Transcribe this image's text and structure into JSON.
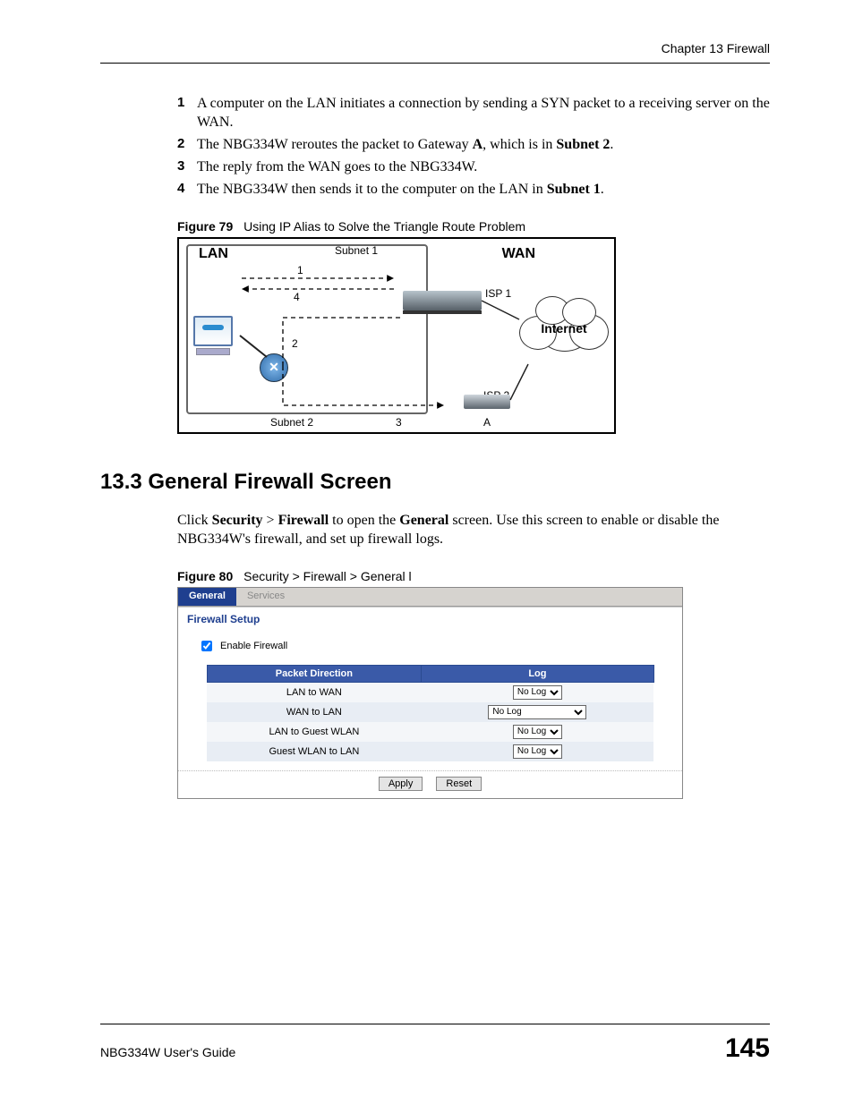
{
  "header": {
    "chapter": "Chapter 13 Firewall"
  },
  "steps": [
    {
      "n": "1",
      "text_before": "A computer on the LAN initiates a connection by sending a SYN packet to a receiving server on the WAN.",
      "bold_parts": []
    },
    {
      "n": "2",
      "text_before": "The NBG334W reroutes the packet to Gateway ",
      "bold1": "A",
      "text_mid": ", which is in ",
      "bold2": "Subnet 2",
      "text_after": "."
    },
    {
      "n": "3",
      "text_before": "The reply from the WAN goes to the NBG334W."
    },
    {
      "n": "4",
      "text_before": "The NBG334W then sends it to the computer on the LAN in ",
      "bold1": "Subnet 1",
      "text_after": "."
    }
  ],
  "fig79": {
    "label_num": "Figure 79",
    "label_title": "Using IP Alias to Solve the Triangle Route Problem",
    "lan": "LAN",
    "wan": "WAN",
    "subnet1": "Subnet 1",
    "subnet2": "Subnet 2",
    "isp1": "ISP 1",
    "isp2": "ISP 2",
    "internet": "Internet",
    "n1": "1",
    "n2": "2",
    "n3": "3",
    "n4": "4",
    "nA": "A",
    "hub": "✕"
  },
  "section": {
    "heading": "13.3  General Firewall Screen",
    "para_plain1": "Click ",
    "b1": "Security",
    "gt1": " > ",
    "b2": "Firewall",
    "mid": " to open the ",
    "b3": "General",
    "tail": " screen. Use this screen to enable or disable the NBG334W's firewall, and set up firewall logs."
  },
  "fig80": {
    "label_num": "Figure 80",
    "label_title": "Security > Firewall > General l",
    "tabs": {
      "general": "General",
      "services": "Services"
    },
    "panel_title": "Firewall Setup",
    "enable_label": "Enable Firewall",
    "columns": {
      "dir": "Packet Direction",
      "log": "Log"
    },
    "rows": [
      {
        "dir": "LAN to WAN",
        "log": "No Log"
      },
      {
        "dir": "WAN to LAN",
        "log": "No Log"
      },
      {
        "dir": "LAN to Guest WLAN",
        "log": "No Log"
      },
      {
        "dir": "Guest WLAN to LAN",
        "log": "No Log"
      }
    ],
    "buttons": {
      "apply": "Apply",
      "reset": "Reset"
    }
  },
  "footer": {
    "guide": "NBG334W User's Guide",
    "page": "145"
  }
}
